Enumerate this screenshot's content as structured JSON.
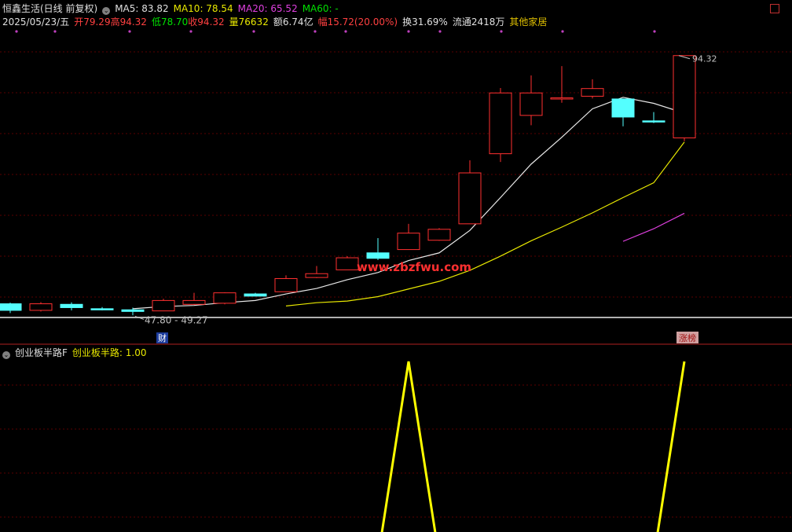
{
  "header": {
    "stock_title": "恒鑫生活(日线 前复权)",
    "ma5": "MA5: 83.82",
    "ma10": "MA10: 78.54",
    "ma20": "MA20: 65.52",
    "ma60": "MA60: -",
    "date": "2025/05/23/五",
    "open": "开79.29",
    "high": "高94.32",
    "low": "低78.70",
    "close": "收94.32",
    "volume": "量76632",
    "amount": "额6.74亿",
    "change": "幅15.72(20.00%)",
    "turnover": "换31.69%",
    "float": "流通2418万",
    "industry": "其他家居"
  },
  "indicator_header": {
    "name": "创业板半路F",
    "value_label": "创业板半路: 1.00"
  },
  "annotations": {
    "high_label": "94.32",
    "low_label": "47.80",
    "range_label": "47.80 - 49.27",
    "finance_badge": "财",
    "limit_up_badge": "涨榜",
    "watermark": "www.zbzfwu.com"
  },
  "colors": {
    "up": "#ff3030",
    "down": "#54ffff",
    "ma5": "#e8e8e8",
    "ma10": "#e8e800",
    "ma20": "#e040e0",
    "indicator": "#ffff00",
    "grid": "#5a0000",
    "watermark": "#ff3030"
  },
  "chart_data": [
    {
      "type": "candlestick",
      "title": "恒鑫生活(日线 前复权)",
      "ylim": [
        46.5,
        98.3
      ],
      "series": [
        {
          "name": "K",
          "ohlc": [
            [
              49.0,
              49.2,
              47.3,
              47.8
            ],
            [
              47.8,
              49.3,
              47.6,
              49.0
            ],
            [
              48.9,
              49.27,
              47.8,
              48.3
            ],
            [
              48.1,
              48.4,
              47.8,
              48.0
            ],
            [
              47.9,
              48.3,
              46.9,
              47.6
            ],
            [
              47.7,
              49.9,
              47.7,
              49.6
            ],
            [
              48.9,
              51.0,
              48.8,
              49.6
            ],
            [
              49.1,
              51.1,
              48.9,
              51.0
            ],
            [
              50.8,
              51.0,
              50.4,
              50.4
            ],
            [
              51.2,
              54.2,
              51.2,
              53.6
            ],
            [
              53.8,
              55.9,
              53.7,
              54.5
            ],
            [
              55.2,
              57.7,
              55.2,
              57.4
            ],
            [
              58.3,
              61.0,
              57.0,
              57.3
            ],
            [
              58.9,
              63.6,
              58.9,
              61.9
            ],
            [
              60.6,
              62.8,
              60.5,
              62.6
            ],
            [
              63.6,
              75.2,
              63.6,
              72.9
            ],
            [
              76.4,
              88.4,
              74.9,
              87.5
            ],
            [
              83.4,
              90.7,
              81.6,
              87.5
            ],
            [
              86.5,
              92.4,
              85.7,
              86.6
            ],
            [
              86.9,
              90.0,
              86.5,
              88.3
            ],
            [
              86.4,
              86.5,
              81.4,
              83.1
            ],
            [
              82.4,
              84.0,
              82.0,
              82.3
            ],
            [
              79.29,
              94.32,
              78.7,
              94.32
            ]
          ]
        },
        {
          "name": "MA5",
          "values": [
            null,
            null,
            null,
            null,
            48.1,
            48.5,
            48.7,
            49.2,
            49.6,
            50.8,
            51.8,
            53.4,
            54.7,
            56.9,
            58.3,
            62.4,
            68.4,
            74.5,
            79.4,
            84.6,
            86.7,
            85.6,
            83.82
          ]
        },
        {
          "name": "MA10",
          "values": [
            null,
            null,
            null,
            null,
            null,
            null,
            null,
            null,
            null,
            48.6,
            49.2,
            49.5,
            50.3,
            51.7,
            53.1,
            55.1,
            57.7,
            60.5,
            63.0,
            65.6,
            68.4,
            71.1,
            78.54
          ]
        },
        {
          "name": "MA20",
          "values": [
            null,
            null,
            null,
            null,
            null,
            null,
            null,
            null,
            null,
            null,
            null,
            null,
            null,
            null,
            null,
            null,
            null,
            null,
            null,
            null,
            60.4,
            62.7,
            65.52
          ]
        }
      ]
    },
    {
      "type": "line",
      "title": "创业板半路F",
      "ylim": [
        0,
        1
      ],
      "series": [
        {
          "name": "创业板半路",
          "values": [
            0,
            0,
            0,
            0,
            0,
            0,
            0,
            0,
            0,
            0,
            0,
            0,
            0,
            1,
            0,
            0,
            0,
            0,
            0,
            0,
            0,
            0,
            1
          ]
        }
      ]
    }
  ]
}
